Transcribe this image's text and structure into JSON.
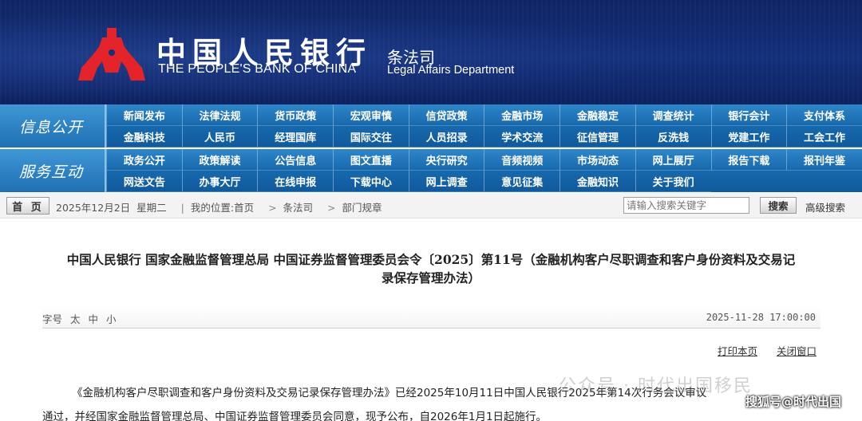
{
  "header": {
    "bank_name_cn": "中国人民银行",
    "bank_name_en": "THE PEOPLE'S BANK OF CHINA",
    "dept_cn": "条法司",
    "dept_en": "Legal Affairs Department",
    "logo_icon": "pboc-emblem-icon",
    "colors": {
      "banner": "#13307a",
      "emblem": "#e4242a"
    }
  },
  "nav": {
    "section1": "信息公开",
    "section2": "服务互动",
    "row1": [
      "新闻发布",
      "法律法规",
      "货币政策",
      "宏观审慎",
      "信贷政策",
      "金融市场",
      "金融稳定",
      "调查统计",
      "银行会计",
      "支付体系",
      "金融科技",
      "人民币",
      "经理国库",
      "国际交往",
      "人员招录",
      "学术交流",
      "征信管理",
      "反洗钱",
      "党建工作",
      "工会工作"
    ],
    "row2": [
      "政务公开",
      "政策解读",
      "公告信息",
      "图文直播",
      "央行研究",
      "音频视频",
      "市场动态",
      "网上展厅",
      "报告下载",
      "报刊年鉴",
      "网送文告",
      "办事大厅",
      "在线申报",
      "下载中心",
      "网上调查",
      "意见征集",
      "金融知识",
      "关于我们"
    ],
    "colors": {
      "bar": "#1869ad"
    }
  },
  "crumb": {
    "home": "首 页",
    "date": "2025年12月2日",
    "weekday": "星期二",
    "sep": "|",
    "location_label": "我的位置:首页",
    "arrow": ">",
    "level2": "条法司",
    "level3": "部门规章",
    "search_placeholder": "请输入搜索关键字",
    "search_button": "搜索",
    "advanced": "高级搜索"
  },
  "article": {
    "title_line1": "中国人民银行 国家金融监督管理总局 中国证券监督管理委员会令〔2025〕第11号（金融机构客户尽职调查和客户身份资料及交易记",
    "title_line2": "录保存管理办法）",
    "font_label": "字号",
    "font_large": "太",
    "font_medium": "中",
    "font_small": "小",
    "date": "2025-11-28 17:00:00",
    "print": "打印本页",
    "close": "关闭窗口",
    "para1": "《金融机构客户尽职调查和客户身份资料及交易记录保存管理办法》已经2025年10月11日中国人民银行2025年第14次行务会议审议",
    "para2": "通过，并经国家金融监督管理总局、中国证券监督管理委员会同意，现予公布，自2026年1月1日起施行。"
  },
  "watermarks": {
    "wechat": "公众号 · 时代出国移民",
    "sohu": "搜狐号@时代出国"
  }
}
